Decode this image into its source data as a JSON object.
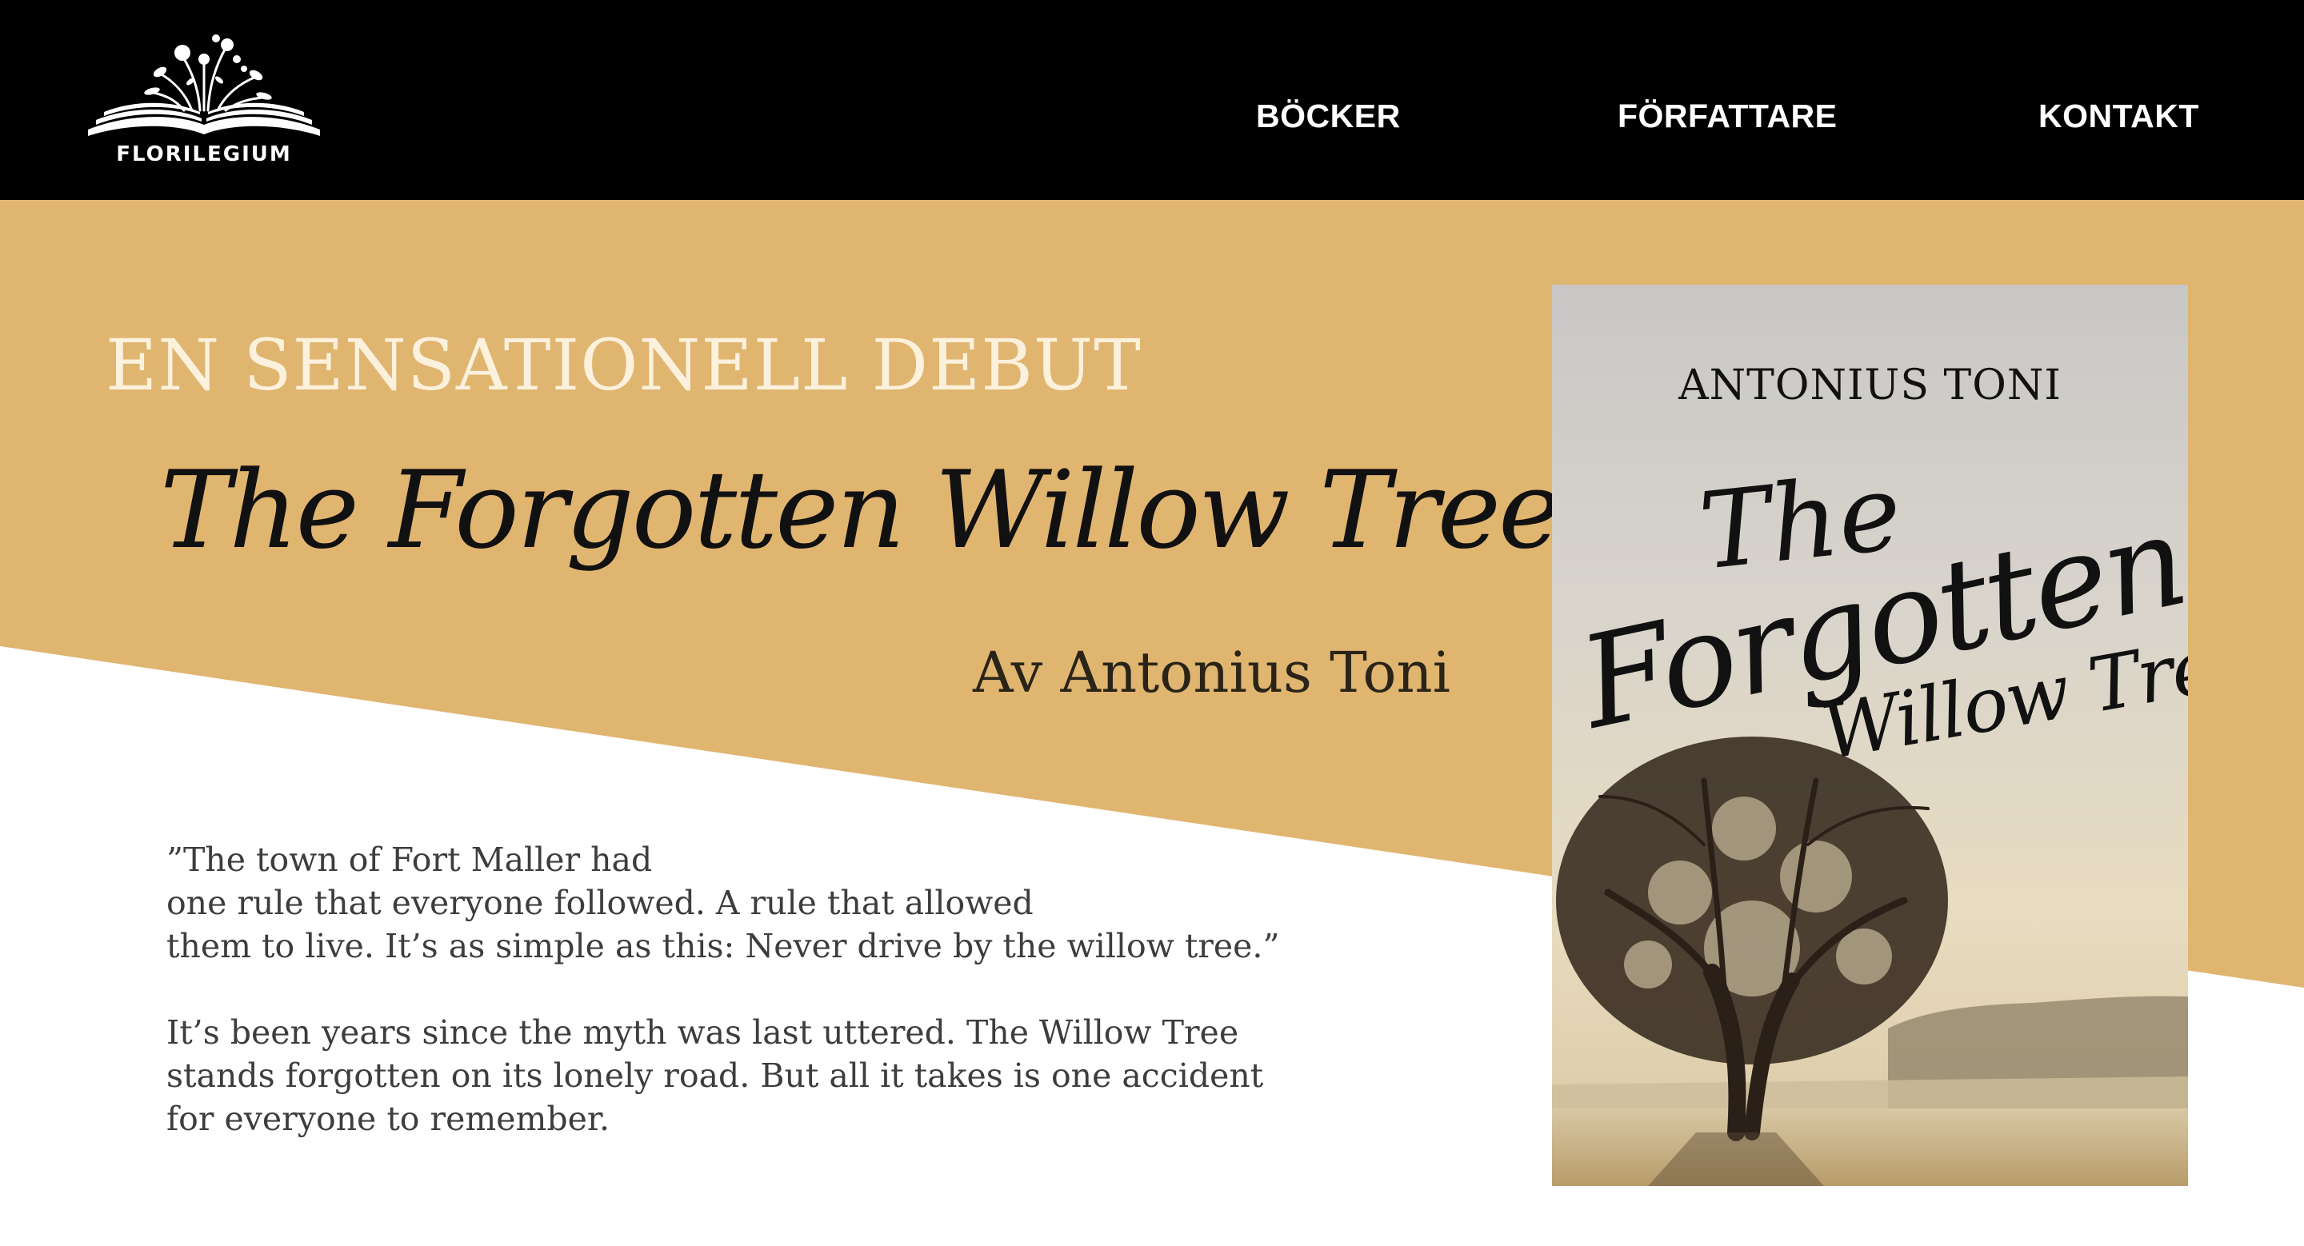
{
  "header": {
    "brand": "FLORILEGIUM",
    "nav": {
      "books": "BÖCKER",
      "authors": "FÖRFATTARE",
      "contact": "KONTAKT"
    }
  },
  "hero": {
    "kicker": "EN SENSATIONELL DEBUT",
    "title": "The Forgotten Willow Tree",
    "byline": "Av Antonius Toni",
    "blurb": {
      "line1": "”The town of Fort Maller had",
      "line2": "one rule that everyone followed. A rule that allowed",
      "line3": "them to live. It’s as simple as this: Never drive by the willow tree.”",
      "line4": "It’s been years since the myth was last uttered. The Willow Tree",
      "line5": "stands forgotten on its lonely road. But all it takes is one accident",
      "line6": "for everyone to remember."
    }
  },
  "cover": {
    "author": "ANTONIUS TONI",
    "title_line1": "The",
    "title_line2": "Forgotten",
    "title_line3": "Willow Tree"
  },
  "colors": {
    "header_bg": "#000000",
    "accent_gold": "#e0b570",
    "kicker_text": "#fbf1dc"
  },
  "icons": {
    "logo": "open-book-with-flowers-icon"
  }
}
